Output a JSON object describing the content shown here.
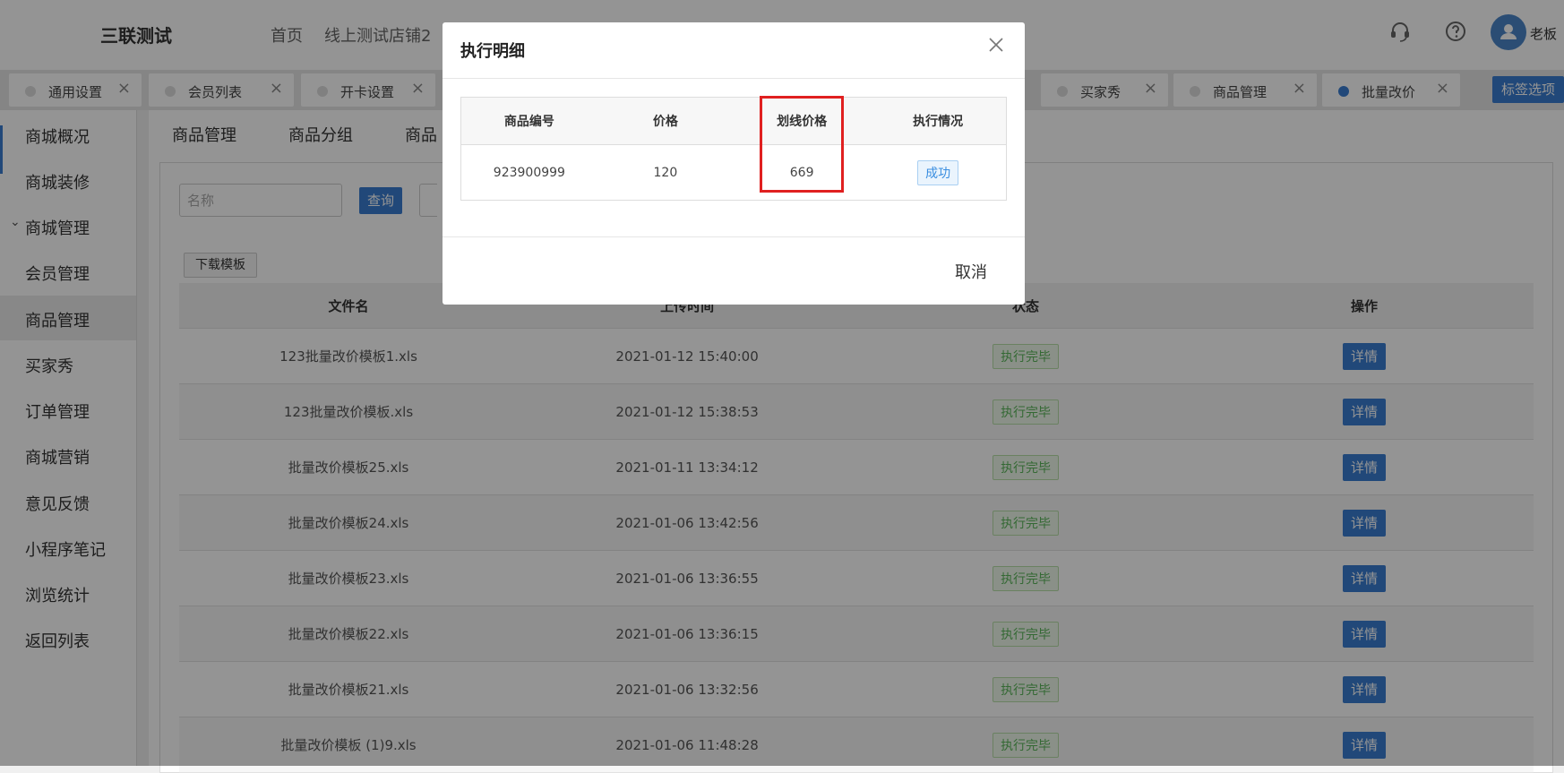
{
  "header": {
    "brand": "三联测试",
    "nav": [
      "首页",
      "线上测试店铺2"
    ],
    "user_name": "老板",
    "icons": [
      "headset-icon",
      "help-icon",
      "user-icon"
    ]
  },
  "tabs": [
    {
      "label": "通用设置",
      "active": false
    },
    {
      "label": "会员列表",
      "active": false
    },
    {
      "label": "开卡设置",
      "active": false
    },
    {
      "label": "买家秀",
      "active": false
    },
    {
      "label": "商品管理",
      "active": false
    },
    {
      "label": "批量改价",
      "active": true
    }
  ],
  "tab_options_label": "标签选项",
  "sidebar": {
    "items": [
      "商城概况",
      "商城装修",
      "商城管理",
      "会员管理",
      "商品管理",
      "买家秀",
      "订单管理",
      "商城营销",
      "意见反馈",
      "小程序笔记",
      "浏览统计",
      "返回列表"
    ],
    "active_index": 4
  },
  "subtabs": [
    "商品管理",
    "商品分组",
    "商品"
  ],
  "search": {
    "placeholder": "名称",
    "query_label": "查询"
  },
  "template_button": "下载模板",
  "file_table": {
    "columns": [
      "文件名",
      "上传时间",
      "状态",
      "操作"
    ],
    "rows": [
      {
        "file": "123批量改价模板1.xls",
        "time": "2021-01-12 15:40:00",
        "status": "执行完毕",
        "action": "详情"
      },
      {
        "file": "123批量改价模板.xls",
        "time": "2021-01-12 15:38:53",
        "status": "执行完毕",
        "action": "详情"
      },
      {
        "file": "批量改价模板25.xls",
        "time": "2021-01-11 13:34:12",
        "status": "执行完毕",
        "action": "详情"
      },
      {
        "file": "批量改价模板24.xls",
        "time": "2021-01-06 13:42:56",
        "status": "执行完毕",
        "action": "详情"
      },
      {
        "file": "批量改价模板23.xls",
        "time": "2021-01-06 13:36:55",
        "status": "执行完毕",
        "action": "详情"
      },
      {
        "file": "批量改价模板22.xls",
        "time": "2021-01-06 13:36:15",
        "status": "执行完毕",
        "action": "详情"
      },
      {
        "file": "批量改价模板21.xls",
        "time": "2021-01-06 13:32:56",
        "status": "执行完毕",
        "action": "详情"
      },
      {
        "file": "批量改价模板 (1)9.xls",
        "time": "2021-01-06 11:48:28",
        "status": "执行完毕",
        "action": "详情"
      }
    ]
  },
  "modal": {
    "title": "执行明细",
    "columns": [
      "商品编号",
      "价格",
      "划线价格",
      "执行情况"
    ],
    "rows": [
      {
        "product_id": "923900999",
        "price": "120",
        "strike_price": "669",
        "result": "成功"
      }
    ],
    "cancel_label": "取消"
  },
  "colors": {
    "accent": "#3a7dd0",
    "highlight": "#e02020",
    "done_green": "#5bb55b"
  }
}
